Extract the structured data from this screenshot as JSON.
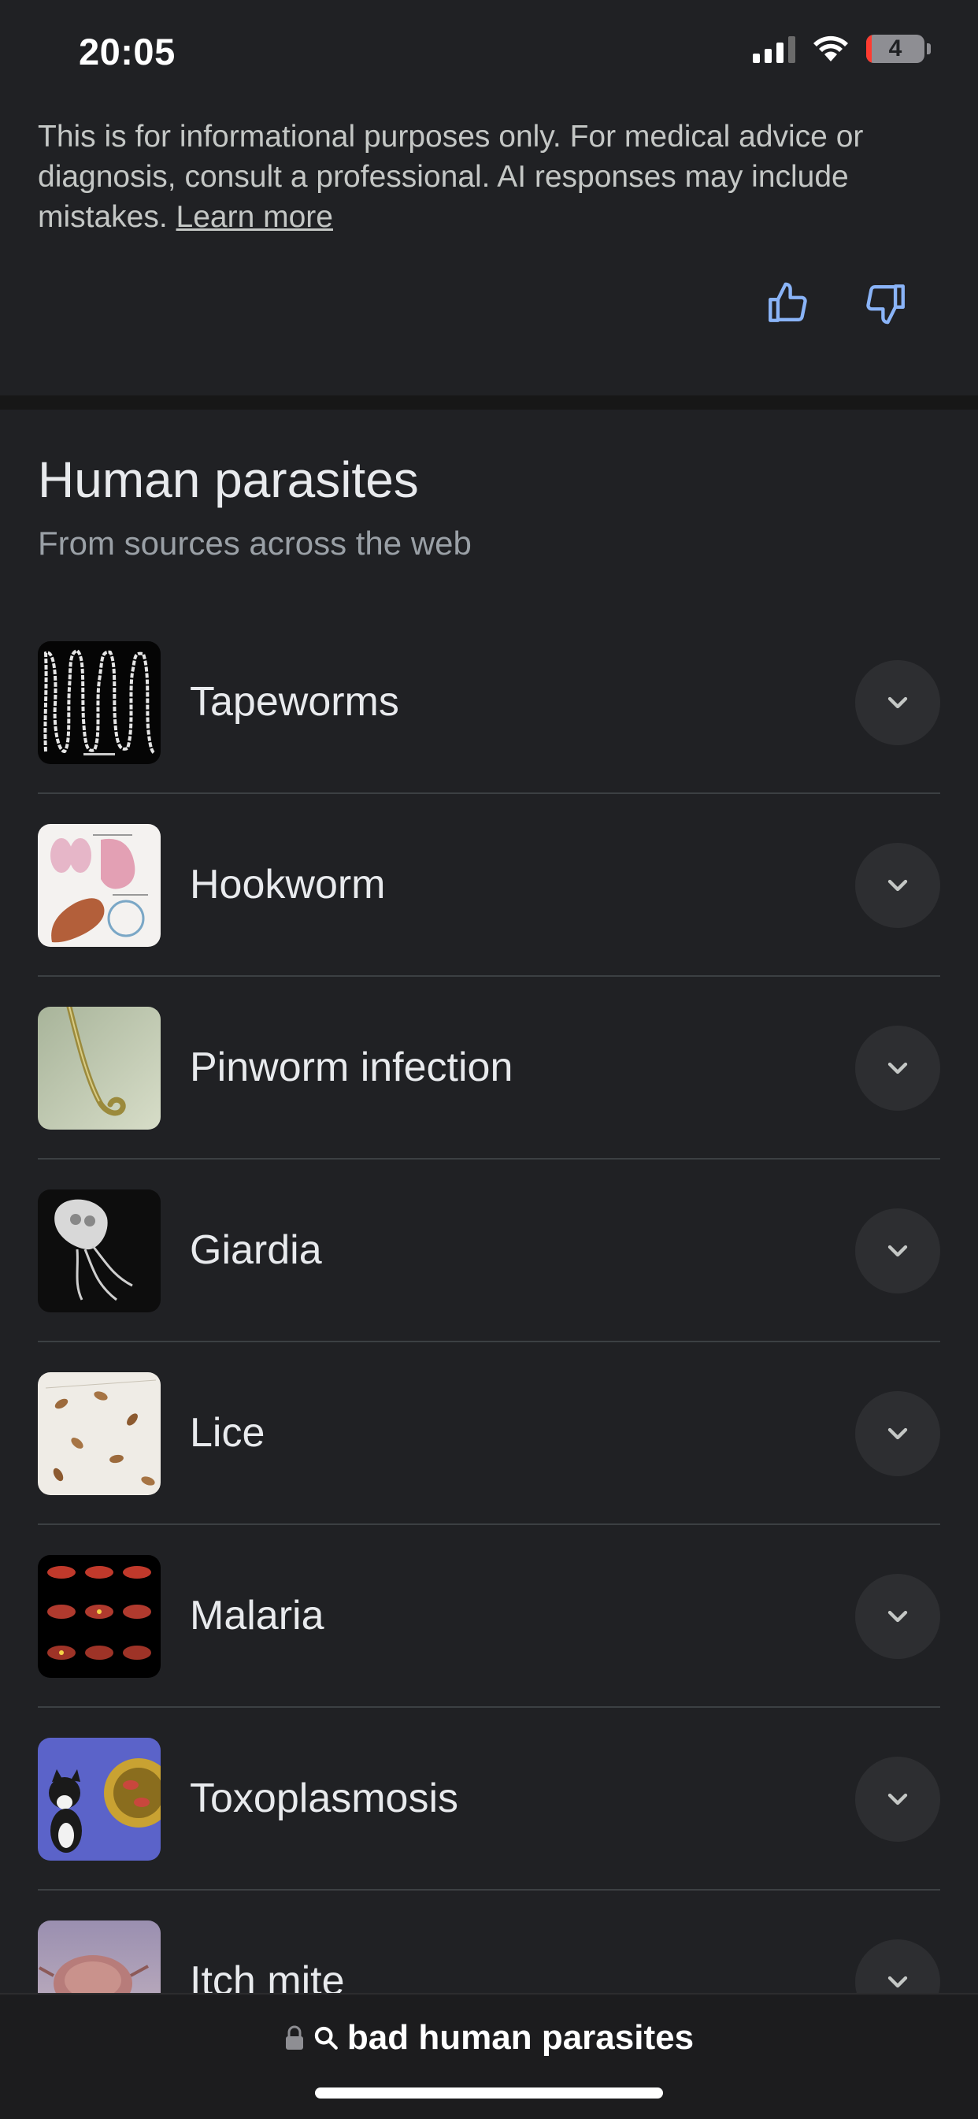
{
  "status_bar": {
    "time": "20:05",
    "battery_level": "4"
  },
  "disclaimer": {
    "text": "This is for informational purposes only. For medical advice or diagnosis, consult a professional. AI responses may include mistakes. ",
    "learn_more": "Learn more"
  },
  "feedback": {
    "thumbs_up_icon": "thumbs-up-icon",
    "thumbs_down_icon": "thumbs-down-icon"
  },
  "section": {
    "title": "Human parasites",
    "subtitle": "From sources across the web",
    "items": [
      {
        "label": "Tapeworms"
      },
      {
        "label": "Hookworm"
      },
      {
        "label": "Pinworm infection"
      },
      {
        "label": "Giardia"
      },
      {
        "label": "Lice"
      },
      {
        "label": "Malaria"
      },
      {
        "label": "Toxoplasmosis"
      },
      {
        "label": "Itch mite"
      }
    ]
  },
  "bottom_bar": {
    "url_text": "bad human parasites"
  },
  "colors": {
    "background": "#202124",
    "accent": "#8ab4f8",
    "divider": "#3c4043"
  }
}
